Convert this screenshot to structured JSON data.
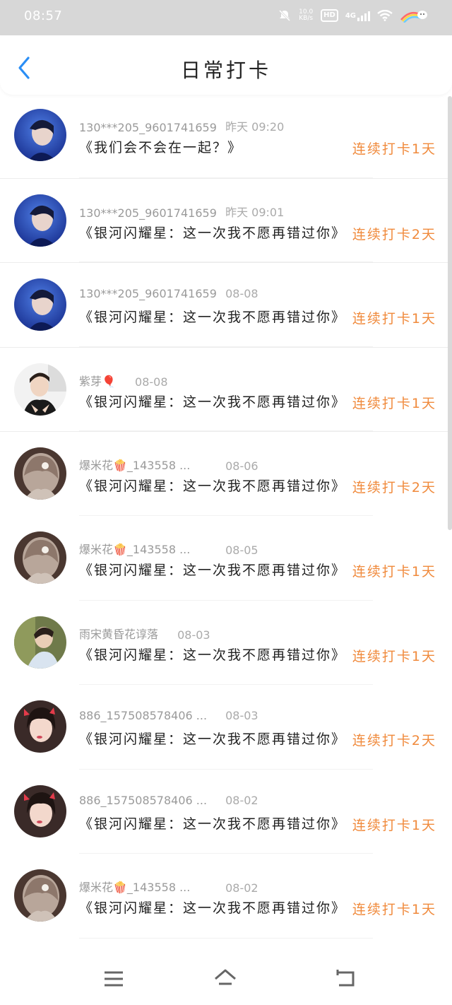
{
  "status_bar": {
    "time": "08:57",
    "net_speed": "10.0 KB/s",
    "hd_label": "HD",
    "network": "4G"
  },
  "header": {
    "title": "日常打卡",
    "back_icon": "chevron-left-icon"
  },
  "colors": {
    "accent_orange": "#f08a3c",
    "back_blue": "#2a8ef5",
    "status_bar_bg": "#d7d7d7"
  },
  "rows": [
    {
      "name": "130***205_9601741659",
      "time": "昨天 09:20",
      "book": "《我们会不会在一起？》",
      "streak": "连续打卡1天",
      "avatar": "avatar-blue-portrait"
    },
    {
      "name": "130***205_9601741659",
      "time": "昨天 09:01",
      "book": "《银河闪耀星：这一次我不愿再错过你》",
      "streak": "连续打卡2天",
      "avatar": "avatar-blue-portrait"
    },
    {
      "name": "130***205_9601741659",
      "time": "08-08",
      "book": "《银河闪耀星：这一次我不愿再错过你》",
      "streak": "连续打卡1天",
      "avatar": "avatar-blue-portrait"
    },
    {
      "name": "紫芽🎈",
      "time": "08-08",
      "book": "《银河闪耀星：这一次我不愿再错过你》",
      "streak": "连续打卡1天",
      "avatar": "avatar-boy"
    },
    {
      "name": "爆米花🍿_143558 ...",
      "time": "08-06",
      "book": "《银河闪耀星：这一次我不愿再错过你》",
      "streak": "连续打卡2天",
      "avatar": "avatar-girl-back"
    },
    {
      "name": "爆米花🍿_143558 ...",
      "time": "08-05",
      "book": "《银河闪耀星：这一次我不愿再错过你》",
      "streak": "连续打卡1天",
      "avatar": "avatar-girl-back"
    },
    {
      "name": "雨宋黄昏花谆落",
      "time": "08-03",
      "book": "《银河闪耀星：这一次我不愿再错过你》",
      "streak": "连续打卡1天",
      "avatar": "avatar-guy"
    },
    {
      "name": "886_157508578406 ...",
      "time": "08-03",
      "book": "《银河闪耀星：这一次我不愿再错过你》",
      "streak": "连续打卡2天",
      "avatar": "avatar-girl-red"
    },
    {
      "name": "886_157508578406 ...",
      "time": "08-02",
      "book": "《银河闪耀星：这一次我不愿再错过你》",
      "streak": "连续打卡1天",
      "avatar": "avatar-girl-red"
    },
    {
      "name": "爆米花🍿_143558 ...",
      "time": "08-02",
      "book": "《银河闪耀星：这一次我不愿再错过你》",
      "streak": "连续打卡1天",
      "avatar": "avatar-girl-back"
    }
  ],
  "nav": {
    "menu_icon": "menu-icon",
    "home_icon": "home-icon",
    "back_icon": "return-icon"
  }
}
